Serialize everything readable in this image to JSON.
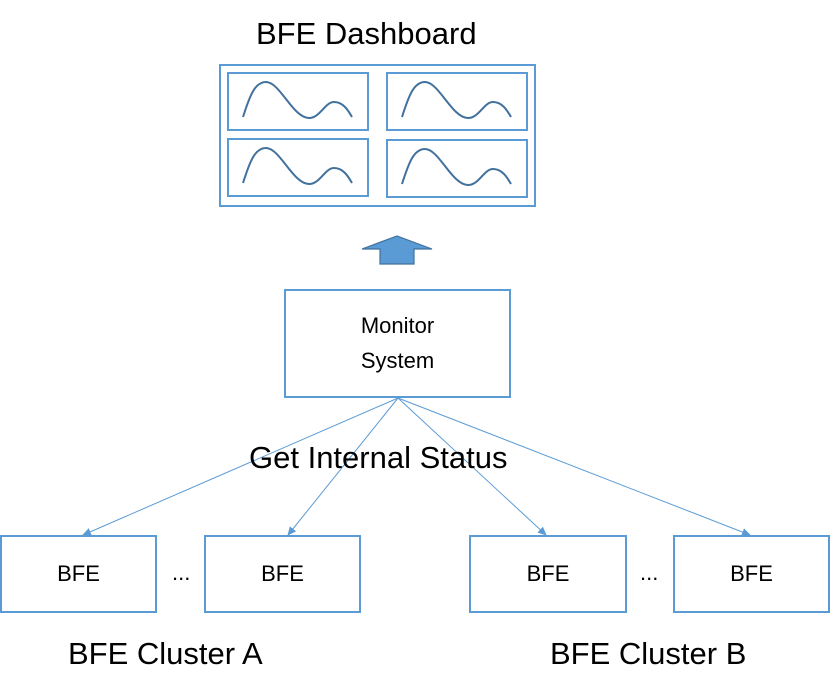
{
  "dashboard": {
    "title": "BFE Dashboard",
    "panels": [
      {
        "name": "chart-panel-1"
      },
      {
        "name": "chart-panel-2"
      },
      {
        "name": "chart-panel-3"
      },
      {
        "name": "chart-panel-4"
      }
    ]
  },
  "monitor": {
    "line1": "Monitor",
    "line2": "System"
  },
  "edge_label": "Get Internal Status",
  "clusters": [
    {
      "label": "BFE Cluster A",
      "nodes": [
        "BFE",
        "BFE"
      ],
      "ellipsis": "..."
    },
    {
      "label": "BFE Cluster B",
      "nodes": [
        "BFE",
        "BFE"
      ],
      "ellipsis": "..."
    }
  ],
  "colors": {
    "stroke": "#5b9bd5",
    "curve": "#41719c",
    "arrow_fill": "#5b9bd5",
    "arrow_stroke": "#41719c"
  }
}
